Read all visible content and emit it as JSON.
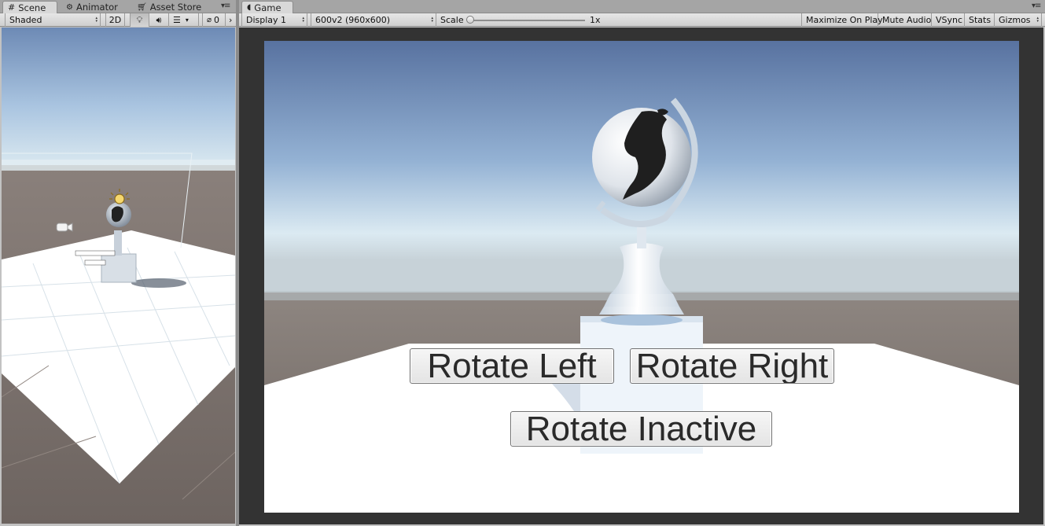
{
  "scene_panel": {
    "tabs": [
      {
        "label": "Scene",
        "icon": "grid-hash-icon"
      },
      {
        "label": "Animator",
        "icon": "animator-icon"
      },
      {
        "label": "Asset Store",
        "icon": "store-icon"
      }
    ],
    "toolbar": {
      "shading_mode": "Shaded",
      "mode_2d": "2D",
      "hidden_count": "0"
    }
  },
  "game_panel": {
    "tab": {
      "label": "Game",
      "icon": "pacman-icon"
    },
    "toolbar": {
      "display": "Display 1",
      "resolution": "600v2 (960x600)",
      "scale_label": "Scale",
      "scale_value": "1x",
      "maximize_on_play": "Maximize On Play",
      "mute_audio": "Mute Audio",
      "vsync": "VSync",
      "stats": "Stats",
      "gizmos": "Gizmos"
    },
    "buttons": {
      "rotate_left": "Rotate Left",
      "rotate_right": "Rotate Right",
      "rotate_inactive": "Rotate Inactive"
    }
  },
  "colors": {
    "sky_top": "#5a74a0",
    "sky_horizon": "#c8ddea",
    "ground": "#6e6560",
    "floor": "#ffffff",
    "game_frame": "#333333"
  }
}
